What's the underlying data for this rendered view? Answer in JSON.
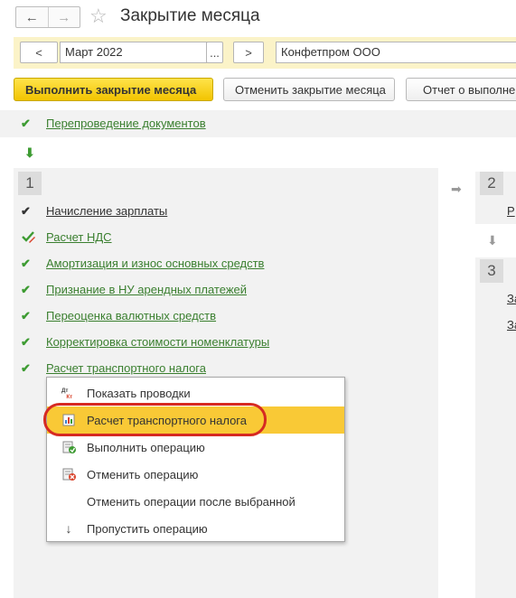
{
  "window": {
    "title": "Закрытие месяца"
  },
  "nav": {
    "back_glyph": "←",
    "forward_glyph": "→",
    "star_glyph": "☆"
  },
  "period": {
    "prev_label": "<",
    "value": "Март 2022",
    "choose_label": "...",
    "next_label": ">",
    "organization": "Конфетпром ООО"
  },
  "actions": {
    "run_label": "Выполнить закрытие месяца",
    "cancel_label": "Отменить закрытие месяца",
    "report_label": "Отчет о выполнен"
  },
  "top_operation": {
    "label": "Перепроведение документов"
  },
  "stages": [
    {
      "number": "1",
      "operations": [
        {
          "label": "Начисление зарплаты",
          "status": "check-dark"
        },
        {
          "label": "Расчет НДС",
          "status": "check-pencil"
        },
        {
          "label": "Амортизация и износ основных средств",
          "status": "check-green"
        },
        {
          "label": "Признание в НУ арендных платежей",
          "status": "check-green"
        },
        {
          "label": "Переоценка валютных средств",
          "status": "check-green"
        },
        {
          "label": "Корректировка стоимости номенклатуры",
          "status": "check-green"
        },
        {
          "label": "Расчет транспортного налога",
          "status": "check-green"
        }
      ]
    },
    {
      "number": "2",
      "operations": [
        {
          "label": "Р"
        }
      ]
    },
    {
      "number": "3",
      "operations": [
        {
          "label": "За"
        },
        {
          "label": "За"
        }
      ]
    }
  ],
  "context_menu": {
    "items": [
      {
        "label": "Показать проводки",
        "icon": "dt-kt-icon"
      },
      {
        "label": "Расчет транспортного налога",
        "icon": "report-icon",
        "active": true
      },
      {
        "label": "Выполнить операцию",
        "icon": "run-operation-icon"
      },
      {
        "label": "Отменить операцию",
        "icon": "cancel-operation-icon"
      },
      {
        "label": "Отменить операции после выбранной",
        "icon": ""
      },
      {
        "label": "Пропустить операцию",
        "icon": "skip-down-arrow-icon"
      }
    ]
  },
  "colors": {
    "accent_yellow": "#f2c400",
    "link_green": "#3a7f2f",
    "highlight_red": "#d62a22",
    "menu_active": "#f9c936"
  }
}
